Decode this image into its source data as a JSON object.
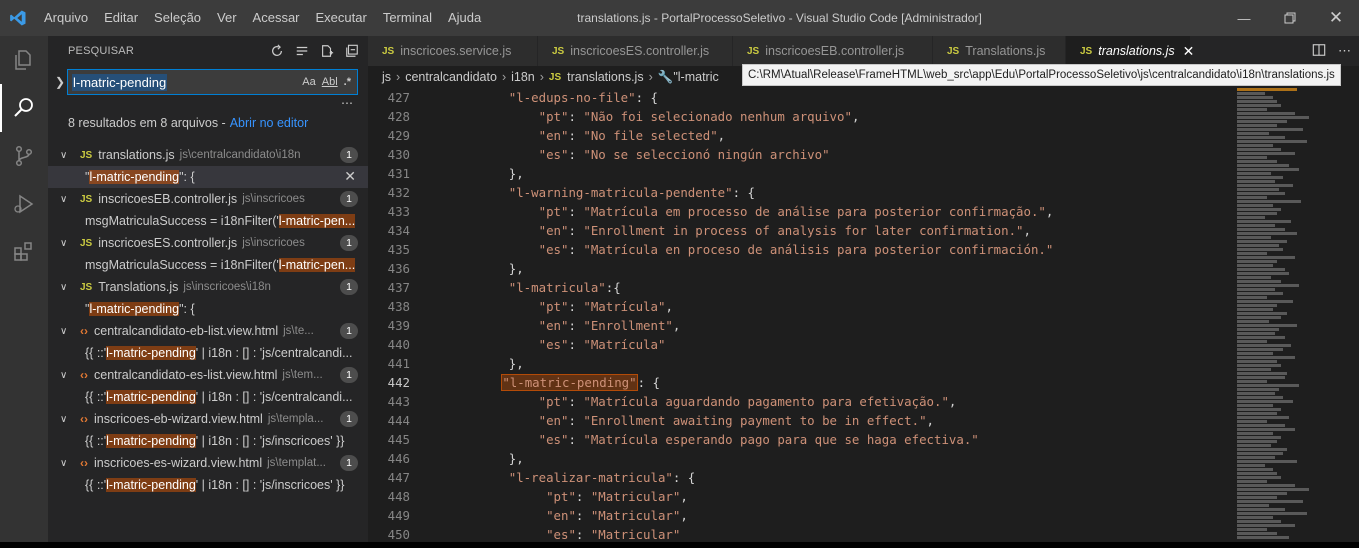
{
  "titlebar": {
    "menu": [
      "Arquivo",
      "Editar",
      "Seleção",
      "Ver",
      "Acessar",
      "Executar",
      "Terminal",
      "Ajuda"
    ],
    "window_title": "translations.js - PortalProcessoSeletivo - Visual Studio Code [Administrador]"
  },
  "sidebar": {
    "header": "PESQUISAR",
    "search_value": "l-matric-pending",
    "opt_case": "Aa",
    "opt_word": "Abl",
    "opt_regex": ".*",
    "results_text": "8 resultados em 8 arquivos -",
    "open_editor_link": "Abrir no editor",
    "files": [
      {
        "name": "translations.js",
        "path": "js\\centralcandidato\\i18n",
        "type": "js",
        "count": "1",
        "match_pre": "\"",
        "match_hl": "l-matric-pending",
        "match_post": "\": {",
        "selected": true
      },
      {
        "name": "inscricoesEB.controller.js",
        "path": "js\\inscricoes",
        "type": "js",
        "count": "1",
        "match_pre": "msgMatriculaSuccess = i18nFilter('",
        "match_hl": "l-matric-pen...",
        "match_post": ""
      },
      {
        "name": "inscricoesES.controller.js",
        "path": "js\\inscricoes",
        "type": "js",
        "count": "1",
        "match_pre": "msgMatriculaSuccess = i18nFilter('",
        "match_hl": "l-matric-pen...",
        "match_post": ""
      },
      {
        "name": "Translations.js",
        "path": "js\\inscricoes\\i18n",
        "type": "js",
        "count": "1",
        "match_pre": "\"",
        "match_hl": "l-matric-pending",
        "match_post": "\": {"
      },
      {
        "name": "centralcandidato-eb-list.view.html",
        "path": "js\\te...",
        "type": "html",
        "count": "1",
        "match_pre": "{{ ::'",
        "match_hl": "l-matric-pending",
        "match_post": "' | i18n : [] : 'js/centralcandi..."
      },
      {
        "name": "centralcandidato-es-list.view.html",
        "path": "js\\tem...",
        "type": "html",
        "count": "1",
        "match_pre": "{{ ::'",
        "match_hl": "l-matric-pending",
        "match_post": "' | i18n : [] : 'js/centralcandi..."
      },
      {
        "name": "inscricoes-eb-wizard.view.html",
        "path": "js\\templa...",
        "type": "html",
        "count": "1",
        "match_pre": "{{ ::'",
        "match_hl": "l-matric-pending",
        "match_post": "' | i18n : [] : 'js/inscricoes' }}"
      },
      {
        "name": "inscricoes-es-wizard.view.html",
        "path": "js\\templat...",
        "type": "html",
        "count": "1",
        "match_pre": "{{ ::'",
        "match_hl": "l-matric-pending",
        "match_post": "' | i18n : [] : 'js/inscricoes' }}"
      }
    ]
  },
  "editor": {
    "tabs": [
      {
        "label": "inscricoes.service.js",
        "active": false
      },
      {
        "label": "inscricoesES.controller.js",
        "active": false
      },
      {
        "label": "inscricoesEB.controller.js",
        "active": false
      },
      {
        "label": "Translations.js",
        "active": false
      },
      {
        "label": "translations.js",
        "active": true
      }
    ],
    "breadcrumb": [
      "js",
      "centralcandidato",
      "i18n",
      "translations.js",
      "\"l-matric"
    ],
    "tooltip": "C:\\RM\\Atual\\Release\\FrameHTML\\web_src\\app\\Edu\\PortalProcessoSeletivo\\js\\centralcandidato\\i18n\\translations.js",
    "lines": [
      {
        "n": "427",
        "indent": "      ",
        "key": "\"l-edups-no-file\"",
        "rest": ": {",
        "val": ""
      },
      {
        "n": "428",
        "indent": "          ",
        "key": "\"pt\"",
        "rest": ": ",
        "val": "\"Não foi selecionado nenhum arquivo\"",
        "end": ","
      },
      {
        "n": "429",
        "indent": "          ",
        "key": "\"en\"",
        "rest": ": ",
        "val": "\"No file selected\"",
        "end": ","
      },
      {
        "n": "430",
        "indent": "          ",
        "key": "\"es\"",
        "rest": ": ",
        "val": "\"No se seleccionó ningún archivo\"",
        "end": ""
      },
      {
        "n": "431",
        "indent": "      ",
        "key": "",
        "rest": "},",
        "val": ""
      },
      {
        "n": "432",
        "indent": "      ",
        "key": "\"l-warning-matricula-pendente\"",
        "rest": ": {",
        "val": ""
      },
      {
        "n": "433",
        "indent": "          ",
        "key": "\"pt\"",
        "rest": ": ",
        "val": "\"Matrícula em processo de análise para posterior confirmação.\"",
        "end": ","
      },
      {
        "n": "434",
        "indent": "          ",
        "key": "\"en\"",
        "rest": ": ",
        "val": "\"Enrollment in process of analysis for later confirmation.\"",
        "end": ","
      },
      {
        "n": "435",
        "indent": "          ",
        "key": "\"es\"",
        "rest": ": ",
        "val": "\"Matrícula en proceso de análisis para posterior confirmación.\"",
        "end": ""
      },
      {
        "n": "436",
        "indent": "      ",
        "key": "",
        "rest": "},",
        "val": ""
      },
      {
        "n": "437",
        "indent": "      ",
        "key": "\"l-matricula\"",
        "rest": ":{",
        "val": ""
      },
      {
        "n": "438",
        "indent": "          ",
        "key": "\"pt\"",
        "rest": ": ",
        "val": "\"Matrícula\"",
        "end": ","
      },
      {
        "n": "439",
        "indent": "          ",
        "key": "\"en\"",
        "rest": ": ",
        "val": "\"Enrollment\"",
        "end": ","
      },
      {
        "n": "440",
        "indent": "          ",
        "key": "\"es\"",
        "rest": ": ",
        "val": "\"Matrícula\"",
        "end": ""
      },
      {
        "n": "441",
        "indent": "      ",
        "key": "",
        "rest": "},",
        "val": ""
      },
      {
        "n": "442",
        "indent": "     ",
        "key": "\"l-matric-pending\"",
        "rest": ": {",
        "val": "",
        "match": true
      },
      {
        "n": "443",
        "indent": "          ",
        "key": "\"pt\"",
        "rest": ": ",
        "val": "\"Matrícula aguardando pagamento para efetivação.\"",
        "end": ","
      },
      {
        "n": "444",
        "indent": "          ",
        "key": "\"en\"",
        "rest": ": ",
        "val": "\"Enrollment awaiting payment to be in effect.\"",
        "end": ","
      },
      {
        "n": "445",
        "indent": "          ",
        "key": "\"es\"",
        "rest": ": ",
        "val": "\"Matrícula esperando pago para que se haga efectiva.\"",
        "end": ""
      },
      {
        "n": "446",
        "indent": "      ",
        "key": "",
        "rest": "},",
        "val": ""
      },
      {
        "n": "447",
        "indent": "      ",
        "key": "\"l-realizar-matricula\"",
        "rest": ": {",
        "val": ""
      },
      {
        "n": "448",
        "indent": "           ",
        "key": "\"pt\"",
        "rest": ": ",
        "val": "\"Matricular\"",
        "end": ","
      },
      {
        "n": "449",
        "indent": "           ",
        "key": "\"en\"",
        "rest": ": ",
        "val": "\"Matricular\"",
        "end": ","
      },
      {
        "n": "450",
        "indent": "           ",
        "key": "\"es\"",
        "rest": ": ",
        "val": "\"Matricular\"",
        "end": ""
      }
    ],
    "current_line": "442"
  },
  "colors": {
    "accent_blue": "#007fd4",
    "js_yellow": "#cbcb41",
    "html_orange": "#e37933",
    "string": "#ce9178",
    "match": "#ea5c00"
  }
}
